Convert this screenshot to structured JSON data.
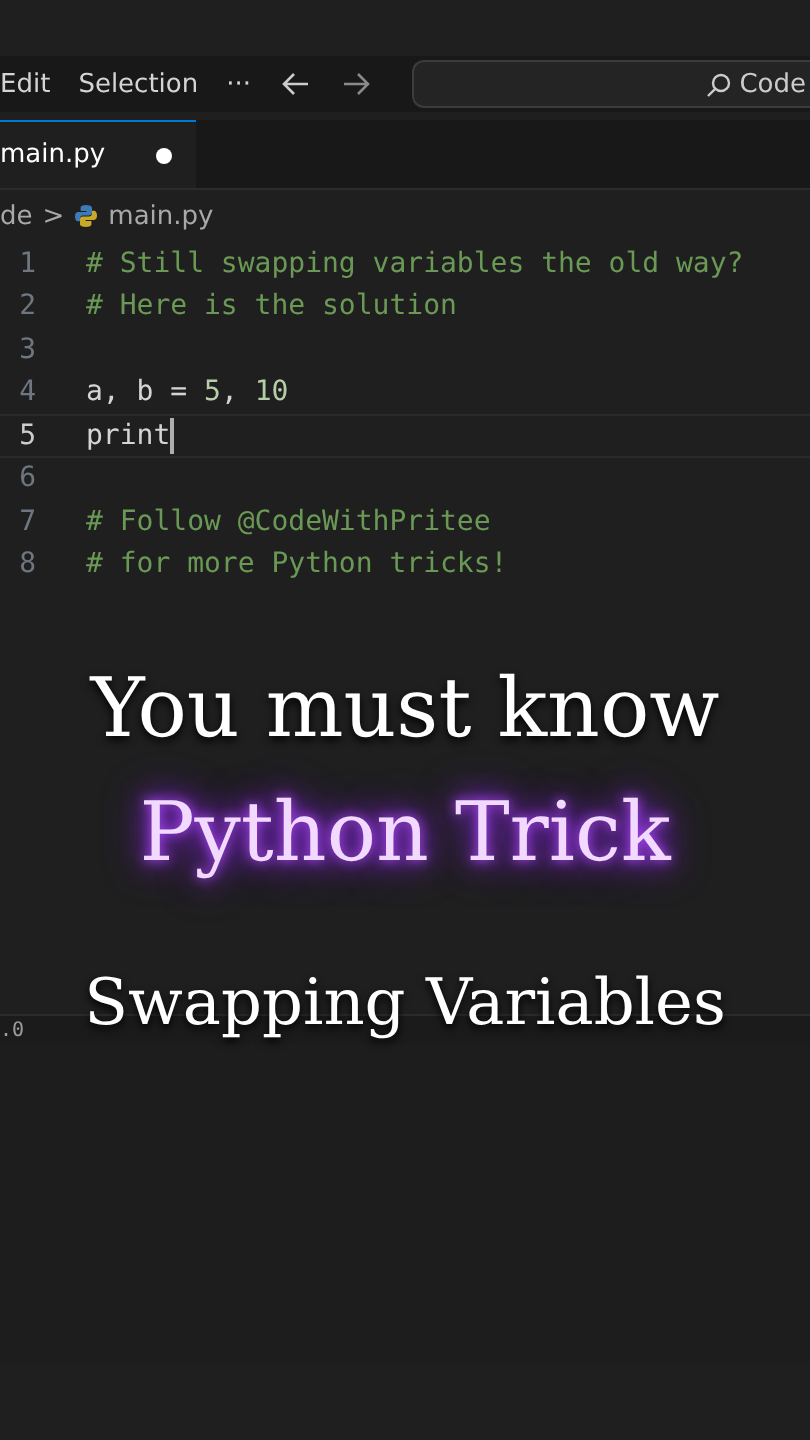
{
  "menu": {
    "items": [
      "Edit",
      "Selection",
      "···"
    ],
    "search": {
      "value": "Code"
    }
  },
  "tabs": [
    {
      "label": "main.py",
      "selected": true,
      "modified": true
    }
  ],
  "breadcrumb": {
    "parts": [
      "de",
      "main.py"
    ],
    "separator": ">"
  },
  "editor": {
    "lines": [
      {
        "number": "1",
        "active": false,
        "tokens": [
          {
            "kind": "comment",
            "text": "# Still swapping variables the old way?"
          }
        ]
      },
      {
        "number": "2",
        "active": false,
        "tokens": [
          {
            "kind": "comment",
            "text": "# Here is the solution"
          }
        ]
      },
      {
        "number": "3",
        "active": false
      },
      {
        "number": "4",
        "active": false,
        "tokens": [
          {
            "kind": "plain",
            "text": "a, b = "
          },
          {
            "kind": "number",
            "text": "5"
          },
          {
            "kind": "plain",
            "text": ", "
          },
          {
            "kind": "number",
            "text": "10"
          }
        ]
      },
      {
        "number": "5",
        "active": true,
        "tokens": [
          {
            "kind": "plain",
            "text": "print"
          }
        ]
      },
      {
        "number": "6",
        "active": false
      },
      {
        "number": "7",
        "active": false,
        "tokens": [
          {
            "kind": "comment",
            "text": "# Follow @CodeWithPritee"
          }
        ]
      },
      {
        "number": "8",
        "active": false,
        "tokens": [
          {
            "kind": "comment",
            "text": "# for more Python tricks!"
          }
        ]
      }
    ]
  },
  "overlay": {
    "headline": "You must know",
    "highlight": "Python Trick",
    "subtitle": "Swapping Variables"
  },
  "panel": {
    "status_text": ".0"
  }
}
